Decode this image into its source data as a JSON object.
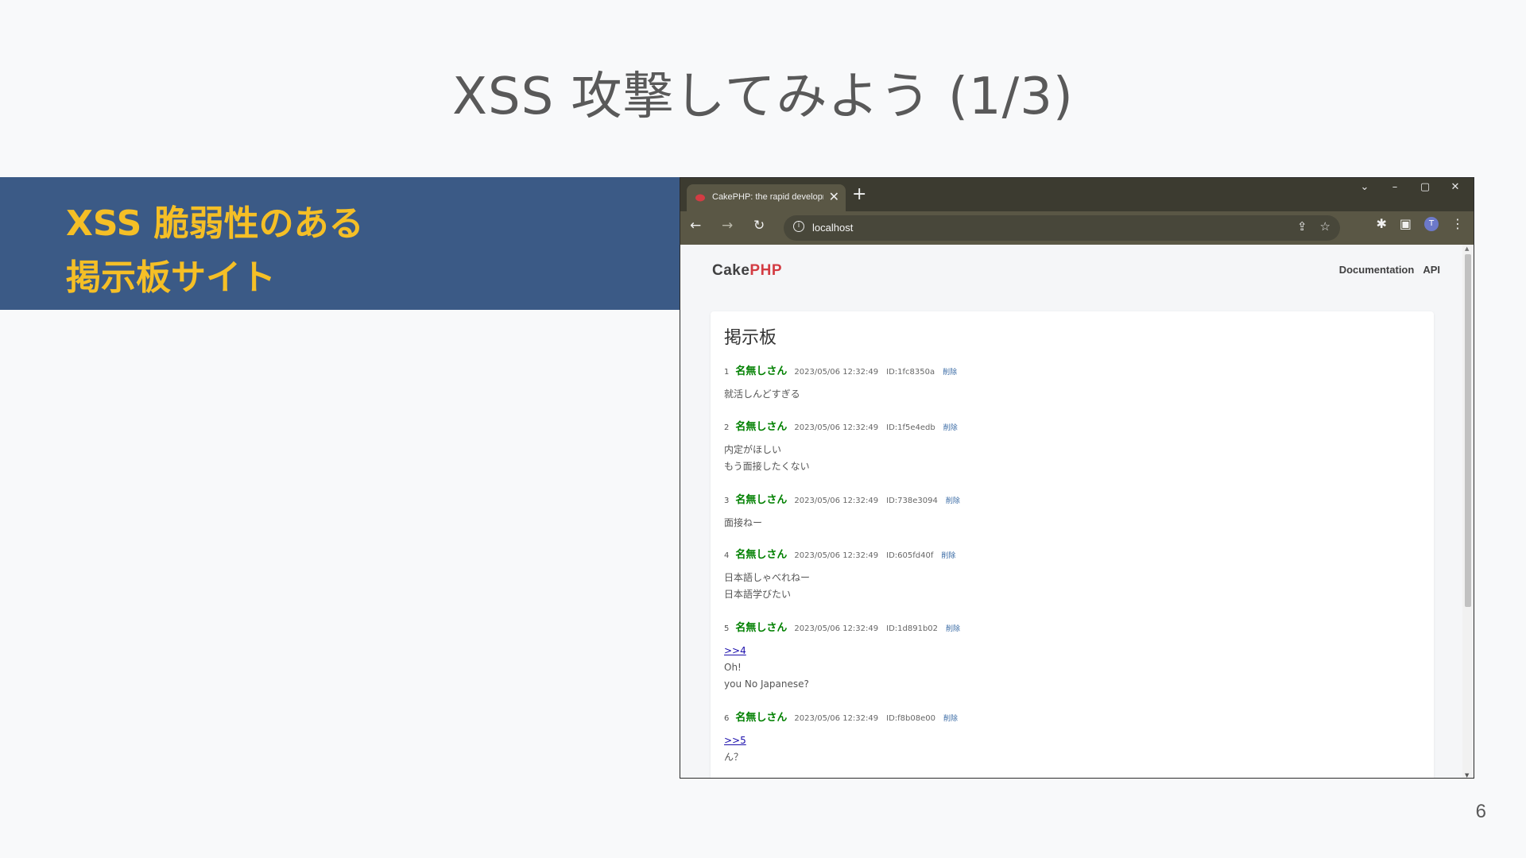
{
  "slide": {
    "title": "XSS 攻撃してみよう (1/3)",
    "banner_line1": "XSS 脆弱性のある",
    "banner_line2": "掲示板サイト",
    "page_number": "6"
  },
  "browser": {
    "tab_title": "CakePHP: the rapid developme",
    "tab_close": "✕",
    "new_tab": "+",
    "win_controls": [
      "⌄",
      "–",
      "▢",
      "✕"
    ],
    "url": "localhost",
    "back": "←",
    "forward": "→",
    "reload": "↻",
    "info_icon": "i",
    "share_icon": "⇪",
    "star_icon": "☆",
    "extensions_icon": "✱",
    "sidepanel_icon": "▣",
    "profile_initial": "T",
    "menu_icon": "⋮"
  },
  "page": {
    "logo_cake": "Cake",
    "logo_php": "PHP",
    "nav": [
      "Documentation",
      "API"
    ],
    "board_title": "掲示板",
    "posts": [
      {
        "num": "1",
        "name": "名無しさん",
        "date": "2023/05/06 12:32:49",
        "id": "ID:1fc8350a",
        "delete": "削除",
        "lines": [
          "就活しんどすぎる"
        ]
      },
      {
        "num": "2",
        "name": "名無しさん",
        "date": "2023/05/06 12:32:49",
        "id": "ID:1f5e4edb",
        "delete": "削除",
        "lines": [
          "内定がほしい",
          "もう面接したくない"
        ]
      },
      {
        "num": "3",
        "name": "名無しさん",
        "date": "2023/05/06 12:32:49",
        "id": "ID:738e3094",
        "delete": "削除",
        "lines": [
          "面接ねー"
        ]
      },
      {
        "num": "4",
        "name": "名無しさん",
        "date": "2023/05/06 12:32:49",
        "id": "ID:605fd40f",
        "delete": "削除",
        "lines": [
          "日本語しゃべれねー",
          "日本語学びたい"
        ]
      },
      {
        "num": "5",
        "name": "名無しさん",
        "date": "2023/05/06 12:32:49",
        "id": "ID:1d891b02",
        "delete": "削除",
        "reply": ">>4",
        "lines": [
          "Oh!",
          "you No Japanese?"
        ]
      },
      {
        "num": "6",
        "name": "名無しさん",
        "date": "2023/05/06 12:32:49",
        "id": "ID:f8b08e00",
        "delete": "削除",
        "reply": ">>5",
        "lines": [
          "ん？"
        ]
      }
    ]
  },
  "colors": {
    "banner_bg": "#3b5a86",
    "banner_text": "#f5bf26",
    "name_green": "#008000",
    "php_red": "#d33c43"
  }
}
